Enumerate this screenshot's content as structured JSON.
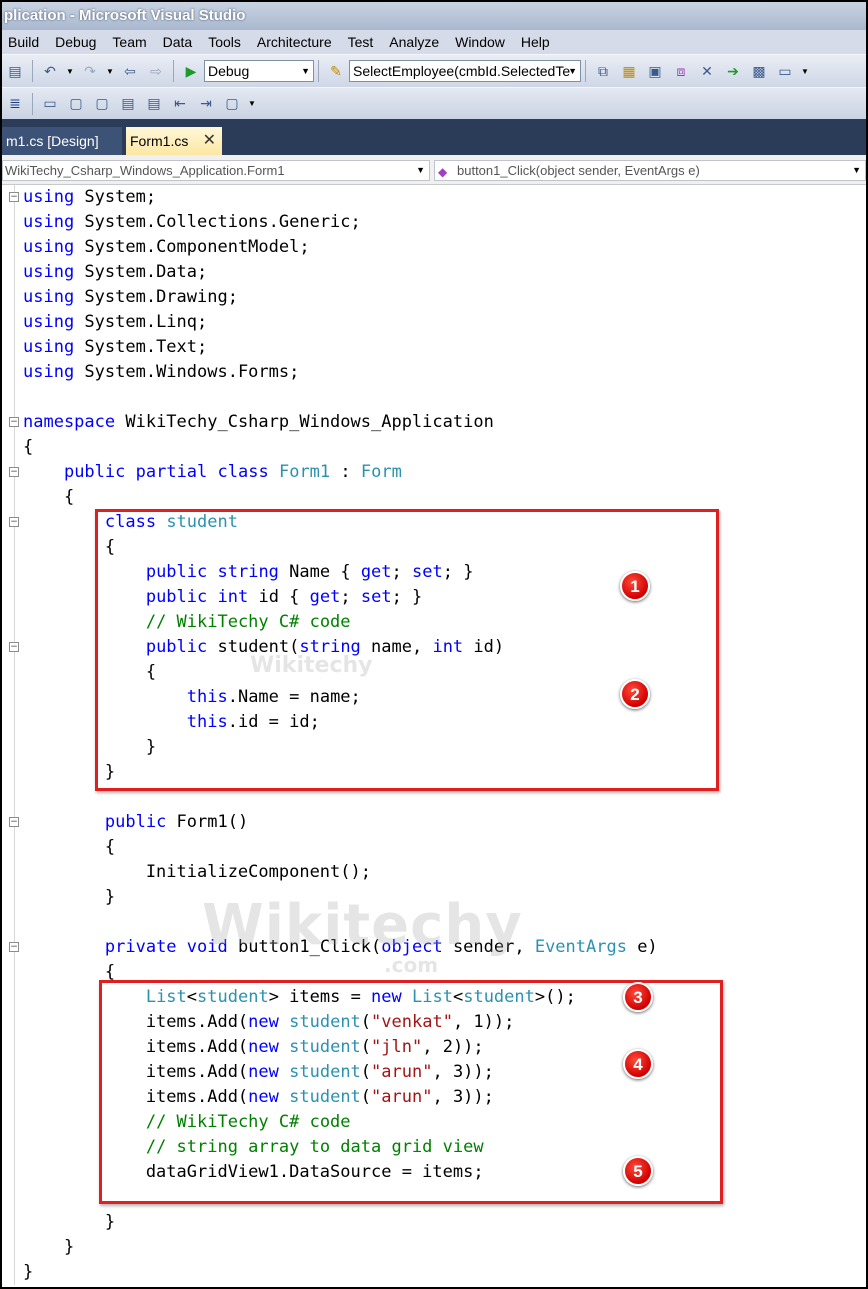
{
  "window": {
    "title": "plication - Microsoft Visual Studio"
  },
  "menu": [
    "Build",
    "Debug",
    "Team",
    "Data",
    "Tools",
    "Architecture",
    "Test",
    "Analyze",
    "Window",
    "Help"
  ],
  "toolbar": {
    "config_combo": "Debug",
    "find_combo": "SelectEmployee(cmbId.SelectedTe"
  },
  "tabs": [
    {
      "label": "m1.cs [Design]",
      "active": false
    },
    {
      "label": "Form1.cs",
      "active": true
    }
  ],
  "navbar": {
    "class_combo": "WikiTechy_Csharp_Windows_Application.Form1",
    "member_combo": "button1_Click(object sender, EventArgs e)"
  },
  "code_lines": [
    "using System;",
    "using System.Collections.Generic;",
    "using System.ComponentModel;",
    "using System.Data;",
    "using System.Drawing;",
    "using System.Linq;",
    "using System.Text;",
    "using System.Windows.Forms;",
    "",
    "namespace WikiTechy_Csharp_Windows_Application",
    "{",
    "    public partial class Form1 : Form",
    "    {",
    "        class student",
    "        {",
    "            public string Name { get; set; }",
    "            public int id { get; set; }",
    "            // WikiTechy C# code",
    "            public student(string name, int id)",
    "            {",
    "                this.Name = name;",
    "                this.id = id;",
    "            }",
    "        }",
    "",
    "        public Form1()",
    "        {",
    "            InitializeComponent();",
    "        }",
    "",
    "        private void button1_Click(object sender, EventArgs e)",
    "        {",
    "            List<student> items = new List<student>();",
    "            items.Add(new student(\"venkat\", 1));",
    "            items.Add(new student(\"jln\", 2));",
    "            items.Add(new student(\"arun\", 3));",
    "            items.Add(new student(\"arun\", 3));",
    "            // WikiTechy C# code",
    "            // string array to data grid view",
    "            dataGridView1.DataSource = items;",
    "",
    "        }",
    "    }",
    "}"
  ],
  "annotations": [
    "1",
    "2",
    "3",
    "4",
    "5"
  ],
  "watermark": {
    "brand": "Wikitechy",
    "domain": ".com"
  },
  "colors": {
    "keyword": "#0000ff",
    "type": "#2b91af",
    "comment": "#008000",
    "string": "#a31515",
    "annotation": "#e02020"
  }
}
